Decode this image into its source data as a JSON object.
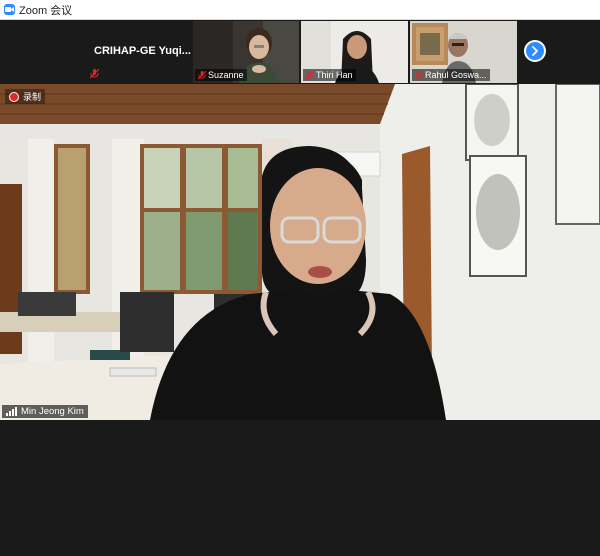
{
  "window": {
    "title": "Zoom 会议"
  },
  "participants": [
    {
      "name": "CRIHAP-GE  Yuqi...",
      "muted": true,
      "video": false
    },
    {
      "name": "Suzanne",
      "muted": true,
      "video": true
    },
    {
      "name": "Thiri Han",
      "muted": true,
      "video": true
    },
    {
      "name": "Rahul Goswa...",
      "muted": true,
      "video": true
    }
  ],
  "navigation": {
    "next_icon": "chevron-right-icon"
  },
  "main": {
    "recording_label": "录制",
    "speaker_name": "Min Jeong Kim"
  },
  "colors": {
    "accent": "#2d8cff",
    "background": "#1a1a1a",
    "muted": "#e02828"
  }
}
